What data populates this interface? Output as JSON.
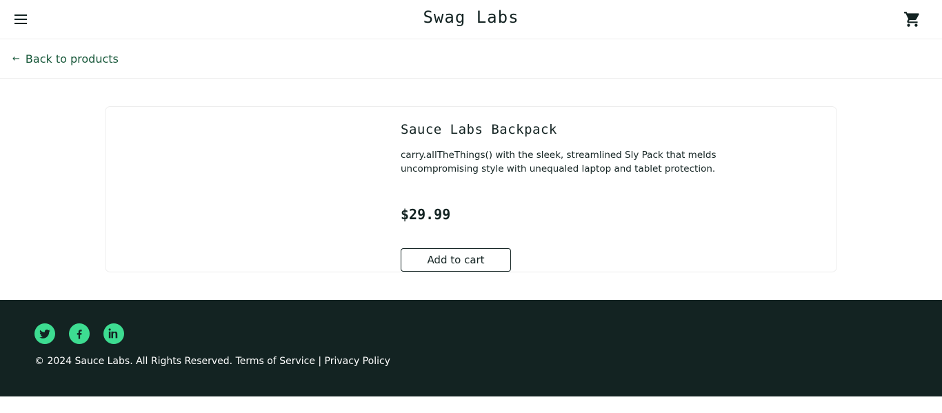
{
  "header": {
    "app_title": "Swag Labs",
    "menu_icon": "hamburger-menu-icon",
    "cart_icon": "shopping-cart-icon"
  },
  "navigation": {
    "back_icon": "arrow-left-icon",
    "back_label": "Back to products"
  },
  "product": {
    "name": "Sauce Labs Backpack",
    "description": "carry.allTheThings() with the sleek, streamlined Sly Pack that melds uncompromising style with unequaled laptop and tablet protection.",
    "price": "$29.99",
    "add_to_cart_label": "Add to cart"
  },
  "footer": {
    "social_icons": [
      "twitter-icon",
      "facebook-icon",
      "linkedin-icon"
    ],
    "copyright": "© 2024 Sauce Labs. All Rights Reserved. Terms of Service | Privacy Policy"
  },
  "colors": {
    "accent_green": "#3ddc91",
    "footer_bg": "#132322",
    "link_green": "#18583a",
    "text_dark": "#132322"
  }
}
